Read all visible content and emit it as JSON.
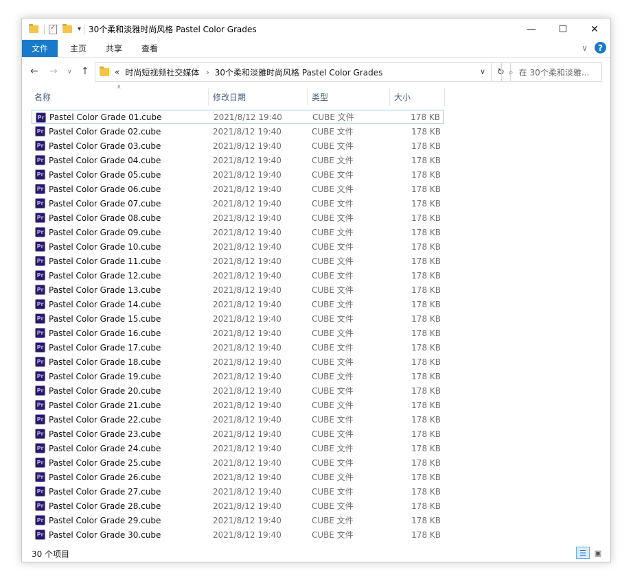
{
  "window": {
    "title": "30个柔和淡雅时尚风格 Pastel Color Grades",
    "controls": {
      "minimize": "—",
      "maximize": "☐",
      "close": "✕"
    }
  },
  "ribbon": {
    "tabs": [
      {
        "label": "文件"
      },
      {
        "label": "主页"
      },
      {
        "label": "共享"
      },
      {
        "label": "查看"
      }
    ],
    "help_icon": "?"
  },
  "address": {
    "prefix": "«",
    "crumbs": [
      "时尚短视频社交媒体",
      "30个柔和淡雅时尚风格 Pastel Color Grades"
    ],
    "search_placeholder": "在 30个柔和淡雅..."
  },
  "columns": {
    "name": "名称",
    "date": "修改日期",
    "type": "类型",
    "size": "大小"
  },
  "file_icon_text": "Pr",
  "files": [
    {
      "name": "Pastel Color Grade 01.cube",
      "date": "2021/8/12 19:40",
      "type": "CUBE 文件",
      "size": "178 KB"
    },
    {
      "name": "Pastel Color Grade 02.cube",
      "date": "2021/8/12 19:40",
      "type": "CUBE 文件",
      "size": "178 KB"
    },
    {
      "name": "Pastel Color Grade 03.cube",
      "date": "2021/8/12 19:40",
      "type": "CUBE 文件",
      "size": "178 KB"
    },
    {
      "name": "Pastel Color Grade 04.cube",
      "date": "2021/8/12 19:40",
      "type": "CUBE 文件",
      "size": "178 KB"
    },
    {
      "name": "Pastel Color Grade 05.cube",
      "date": "2021/8/12 19:40",
      "type": "CUBE 文件",
      "size": "178 KB"
    },
    {
      "name": "Pastel Color Grade 06.cube",
      "date": "2021/8/12 19:40",
      "type": "CUBE 文件",
      "size": "178 KB"
    },
    {
      "name": "Pastel Color Grade 07.cube",
      "date": "2021/8/12 19:40",
      "type": "CUBE 文件",
      "size": "178 KB"
    },
    {
      "name": "Pastel Color Grade 08.cube",
      "date": "2021/8/12 19:40",
      "type": "CUBE 文件",
      "size": "178 KB"
    },
    {
      "name": "Pastel Color Grade 09.cube",
      "date": "2021/8/12 19:40",
      "type": "CUBE 文件",
      "size": "178 KB"
    },
    {
      "name": "Pastel Color Grade 10.cube",
      "date": "2021/8/12 19:40",
      "type": "CUBE 文件",
      "size": "178 KB"
    },
    {
      "name": "Pastel Color Grade 11.cube",
      "date": "2021/8/12 19:40",
      "type": "CUBE 文件",
      "size": "178 KB"
    },
    {
      "name": "Pastel Color Grade 12.cube",
      "date": "2021/8/12 19:40",
      "type": "CUBE 文件",
      "size": "178 KB"
    },
    {
      "name": "Pastel Color Grade 13.cube",
      "date": "2021/8/12 19:40",
      "type": "CUBE 文件",
      "size": "178 KB"
    },
    {
      "name": "Pastel Color Grade 14.cube",
      "date": "2021/8/12 19:40",
      "type": "CUBE 文件",
      "size": "178 KB"
    },
    {
      "name": "Pastel Color Grade 15.cube",
      "date": "2021/8/12 19:40",
      "type": "CUBE 文件",
      "size": "178 KB"
    },
    {
      "name": "Pastel Color Grade 16.cube",
      "date": "2021/8/12 19:40",
      "type": "CUBE 文件",
      "size": "178 KB"
    },
    {
      "name": "Pastel Color Grade 17.cube",
      "date": "2021/8/12 19:40",
      "type": "CUBE 文件",
      "size": "178 KB"
    },
    {
      "name": "Pastel Color Grade 18.cube",
      "date": "2021/8/12 19:40",
      "type": "CUBE 文件",
      "size": "178 KB"
    },
    {
      "name": "Pastel Color Grade 19.cube",
      "date": "2021/8/12 19:40",
      "type": "CUBE 文件",
      "size": "178 KB"
    },
    {
      "name": "Pastel Color Grade 20.cube",
      "date": "2021/8/12 19:40",
      "type": "CUBE 文件",
      "size": "178 KB"
    },
    {
      "name": "Pastel Color Grade 21.cube",
      "date": "2021/8/12 19:40",
      "type": "CUBE 文件",
      "size": "178 KB"
    },
    {
      "name": "Pastel Color Grade 22.cube",
      "date": "2021/8/12 19:40",
      "type": "CUBE 文件",
      "size": "178 KB"
    },
    {
      "name": "Pastel Color Grade 23.cube",
      "date": "2021/8/12 19:40",
      "type": "CUBE 文件",
      "size": "178 KB"
    },
    {
      "name": "Pastel Color Grade 24.cube",
      "date": "2021/8/12 19:40",
      "type": "CUBE 文件",
      "size": "178 KB"
    },
    {
      "name": "Pastel Color Grade 25.cube",
      "date": "2021/8/12 19:40",
      "type": "CUBE 文件",
      "size": "178 KB"
    },
    {
      "name": "Pastel Color Grade 26.cube",
      "date": "2021/8/12 19:40",
      "type": "CUBE 文件",
      "size": "178 KB"
    },
    {
      "name": "Pastel Color Grade 27.cube",
      "date": "2021/8/12 19:40",
      "type": "CUBE 文件",
      "size": "178 KB"
    },
    {
      "name": "Pastel Color Grade 28.cube",
      "date": "2021/8/12 19:40",
      "type": "CUBE 文件",
      "size": "178 KB"
    },
    {
      "name": "Pastel Color Grade 29.cube",
      "date": "2021/8/12 19:40",
      "type": "CUBE 文件",
      "size": "178 KB"
    },
    {
      "name": "Pastel Color Grade 30.cube",
      "date": "2021/8/12 19:40",
      "type": "CUBE 文件",
      "size": "178 KB"
    }
  ],
  "status": {
    "count": "30 个项目"
  },
  "colors": {
    "accent": "#1979ca",
    "header_text": "#4c607a",
    "folder": "#f5c54a"
  }
}
